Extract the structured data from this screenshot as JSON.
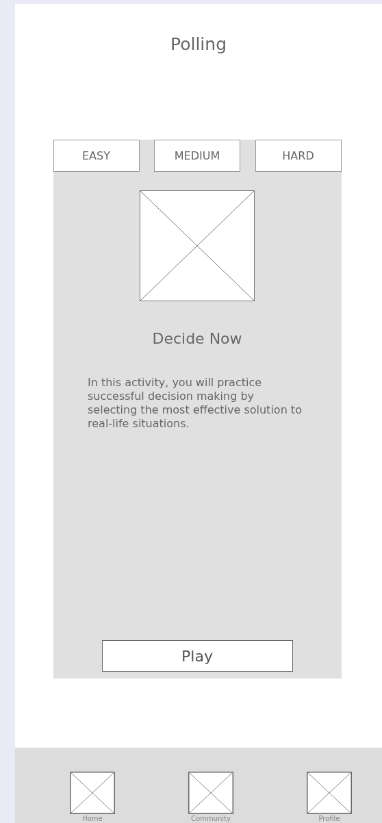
{
  "title": "Polling",
  "tabs": [
    {
      "label": "EASY"
    },
    {
      "label": "MEDIUM"
    },
    {
      "label": "HARD"
    }
  ],
  "activity": {
    "title": "Decide Now",
    "description": "In this activity, you will practice successful decision making by selecting the most effective solution to real-life situations.",
    "button": "Play"
  },
  "nav": [
    {
      "label": "Home"
    },
    {
      "label": "Community"
    },
    {
      "label": "Profile"
    }
  ]
}
